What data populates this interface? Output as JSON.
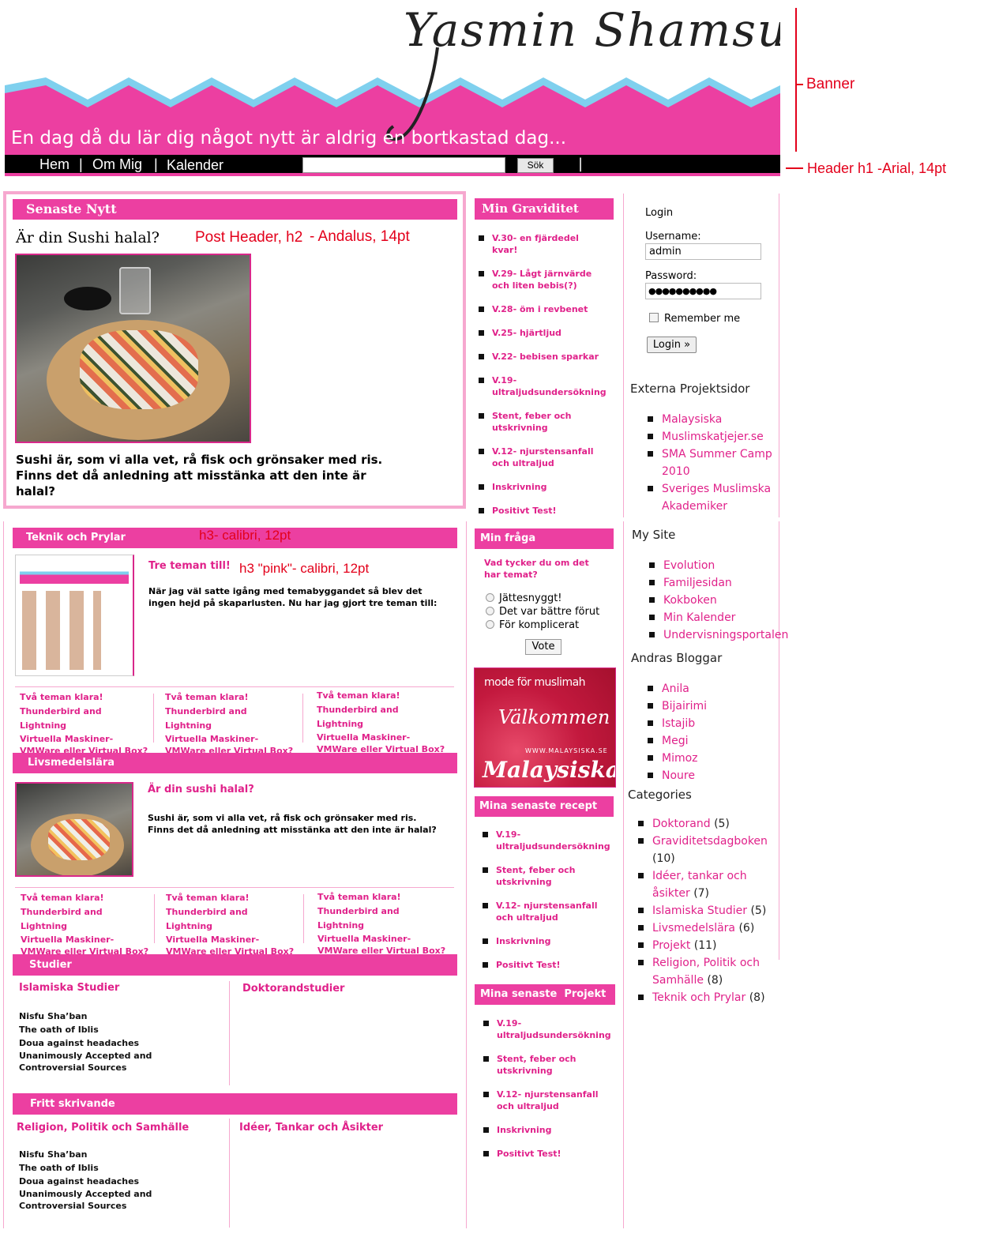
{
  "banner": {
    "title": "Yasmin Shamsudin",
    "tagline": "En dag då du lär dig något nytt är aldrig en bortkastad dag..."
  },
  "nav": {
    "items": [
      "Hem",
      "Om Mig",
      "Kalender"
    ],
    "search_button": "Sök"
  },
  "annotations": {
    "banner": "Banner",
    "header": "Header  h1 -Arial, 14pt",
    "post_header": "Post Header, h2",
    "post_header_font": "- Andalus, 14pt",
    "h3": "h3- calibri, 12pt",
    "h3_pink": "h3 \"pink\"- calibri, 12pt"
  },
  "senaste": {
    "heading": "Senaste Nytt",
    "post_title": "Är din Sushi halal?",
    "post_body": "Sushi är, som vi alla vet, rå fisk och grönsaker med ris. Finns det då anledning att misstänka att den inte är halal?"
  },
  "teknik": {
    "heading": "Teknik och Prylar",
    "post_title": "Tre teman till!",
    "post_body": "När jag väl satte igång med temabyggandet så blev det ingen hejd på skaparlusten. Nu har jag gjort tre teman till:",
    "links": [
      "Två teman klara!",
      "Thunderbird and Lightning",
      "Virtuella Maskiner- VMWare eller Virtual Box?"
    ]
  },
  "livsmedel": {
    "heading": "Livsmedelslära",
    "post_title": "Är din sushi halal?",
    "post_body": "Sushi är, som vi alla vet, rå fisk och grönsaker med ris. Finns det då anledning att misstänka att den inte är halal?",
    "links": [
      "Två teman klara!",
      "Thunderbird and Lightning",
      "Virtuella Maskiner- VMWare eller Virtual Box?"
    ]
  },
  "studier": {
    "heading": "Studier",
    "col1_title": "Islamiska Studier",
    "col2_title": "Doktorandstudier",
    "items": [
      "Nisfu Sha’ban",
      "The oath of Iblis",
      "Doua against headaches",
      "Unanimously Accepted and Controversial Sources"
    ]
  },
  "fritt": {
    "heading": "Fritt skrivande",
    "col1_title": "Religion, Politik och Samhälle",
    "col2_title": "Idéer, Tankar och Åsikter",
    "items": [
      "Nisfu Sha’ban",
      "The oath of Iblis",
      "Doua against headaches",
      "Unanimously Accepted and Controversial Sources"
    ]
  },
  "graviditet": {
    "heading": "Min Graviditet",
    "items": [
      "V.30- en fjärdedel kvar!",
      "V.29- Lågt järnvärde och liten bebis(?)",
      "V.28- öm i revbenet",
      "V.25- hjärtljud",
      "V.22- bebisen sparkar",
      "V.19- ultraljudsundersökning",
      "Stent, feber och utskrivning",
      "V.12- njurstensanfall och ultraljud",
      "Inskrivning",
      "Positivt Test!"
    ]
  },
  "poll": {
    "heading": "Min fråga",
    "question": "Vad tycker du om det har temat?",
    "options": [
      "Jättesnyggt!",
      "Det var bättre förut",
      "För komplicerat"
    ],
    "vote": "Vote"
  },
  "ad": {
    "line1": "mode för muslimah",
    "line2": "Välkommen",
    "url": "WWW.MALAYSISKA.SE",
    "brand": "Malaysiska"
  },
  "recept": {
    "heading": "Mina senaste recept",
    "items": [
      "V.19- ultraljudsundersökning",
      "Stent, feber och utskrivning",
      "V.12- njurstensanfall och ultraljud",
      "Inskrivning",
      "Positivt Test!"
    ]
  },
  "projekt": {
    "heading": "Mina senaste  Projekt",
    "items": [
      "V.19- ultraljudsundersökning",
      "Stent, feber och utskrivning",
      "V.12- njurstensanfall och ultraljud",
      "Inskrivning",
      "Positivt Test!"
    ]
  },
  "login": {
    "title": "Login",
    "username_label": "Username:",
    "username_value": "admin",
    "password_label": "Password:",
    "password_value": "●●●●●●●●●●",
    "remember": "Remember me",
    "button": "Login »"
  },
  "externa": {
    "heading": "Externa Projektsidor",
    "items": [
      "Malaysiska",
      "Muslimskatjejer.se",
      "SMA Summer Camp 2010",
      "Sveriges Muslimska Akademiker"
    ]
  },
  "mysite": {
    "heading": "My Site",
    "items": [
      "Evolution",
      "Familjesidan",
      "Kokboken",
      "Min Kalender",
      "Undervisningsportalen"
    ]
  },
  "andras": {
    "heading": "Andras Bloggar",
    "items": [
      "Anila",
      "Bijairimi",
      "Istajib",
      "Megi",
      "Mimoz",
      "Noure"
    ]
  },
  "categories": {
    "heading": "Categories",
    "items": [
      {
        "name": "Doktorand",
        "count": "(5)"
      },
      {
        "name": "Graviditetsdagboken",
        "count": "(10)"
      },
      {
        "name": "Idéer, tankar och åsikter",
        "count": "(7)"
      },
      {
        "name": "Islamiska Studier",
        "count": "(5)"
      },
      {
        "name": "Livsmedelslära",
        "count": "(6)"
      },
      {
        "name": "Projekt",
        "count": "(11)"
      },
      {
        "name": "Religion, Politik och Samhälle",
        "count": "(8)"
      },
      {
        "name": "Teknik och Prylar",
        "count": "(8)"
      }
    ]
  },
  "colors": {
    "pink": "#ec3fa1",
    "light_blue": "#7fd0ee",
    "link_pink": "#e0218a",
    "light_pink_border": "#f6a8cf"
  }
}
